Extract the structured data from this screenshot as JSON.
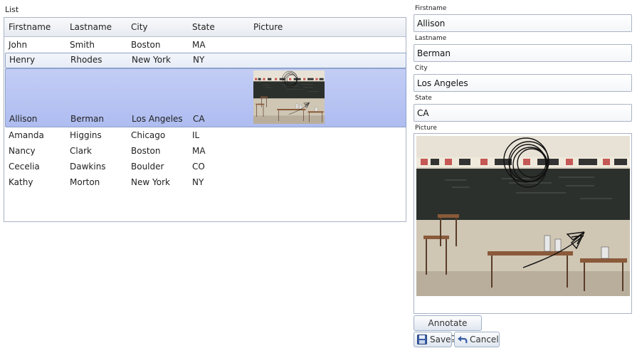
{
  "list": {
    "title": "List",
    "columns": [
      "Firstname",
      "Lastname",
      "City",
      "State",
      "Picture"
    ],
    "rows": [
      {
        "firstname": "John",
        "lastname": "Smith",
        "city": "Boston",
        "state": "MA"
      },
      {
        "firstname": "Henry",
        "lastname": "Rhodes",
        "city": "New York",
        "state": "NY"
      },
      {
        "firstname": "Allison",
        "lastname": "Berman",
        "city": "Los Angeles",
        "state": "CA"
      },
      {
        "firstname": "Amanda",
        "lastname": "Higgins",
        "city": "Chicago",
        "state": "IL"
      },
      {
        "firstname": "Nancy",
        "lastname": "Clark",
        "city": "Boston",
        "state": "MA"
      },
      {
        "firstname": "Cecelia",
        "lastname": "Dawkins",
        "city": "Boulder",
        "state": "CO"
      },
      {
        "firstname": "Kathy",
        "lastname": "Morton",
        "city": "New York",
        "state": "NY"
      }
    ],
    "selected_index": 2,
    "hover_index": 1
  },
  "details": {
    "firstname_label": "Firstname",
    "firstname_value": "Allison",
    "lastname_label": "Lastname",
    "lastname_value": "Berman",
    "city_label": "City",
    "city_value": "Los Angeles",
    "state_label": "State",
    "state_value": "CA",
    "picture_label": "Picture"
  },
  "buttons": {
    "annotate": "Annotate Image",
    "save": "Save",
    "cancel": "Cancel"
  },
  "icons": {
    "save": "floppy-disk-icon",
    "cancel": "undo-arrow-icon"
  },
  "colors": {
    "selected_row": "#b4c1f2",
    "border": "#aab4c4"
  }
}
